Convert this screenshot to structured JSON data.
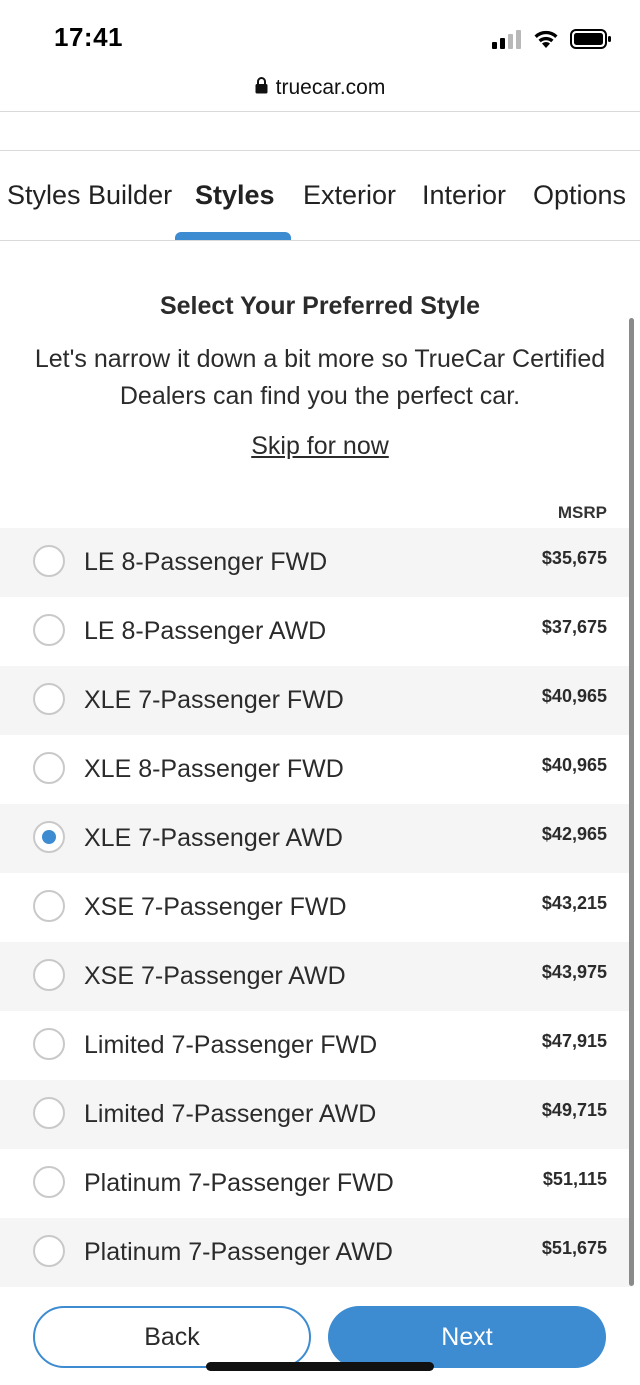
{
  "status_bar": {
    "time": "17:41"
  },
  "url_bar": {
    "domain": "truecar.com"
  },
  "tabs": [
    {
      "label": "Styles Builder",
      "active": false
    },
    {
      "label": "Styles",
      "active": true
    },
    {
      "label": "Exterior",
      "active": false
    },
    {
      "label": "Interior",
      "active": false
    },
    {
      "label": "Options",
      "active": false
    }
  ],
  "intro": {
    "title": "Select Your Preferred Style",
    "description": "Let's narrow it down a bit more so TrueCar Certified Dealers can find you the perfect car.",
    "skip_label": "Skip for now"
  },
  "list": {
    "price_header": "MSRP",
    "styles": [
      {
        "name": "LE 8-Passenger FWD",
        "price": "$35,675",
        "selected": false
      },
      {
        "name": "LE 8-Passenger AWD",
        "price": "$37,675",
        "selected": false
      },
      {
        "name": "XLE 7-Passenger FWD",
        "price": "$40,965",
        "selected": false
      },
      {
        "name": "XLE 8-Passenger FWD",
        "price": "$40,965",
        "selected": false
      },
      {
        "name": "XLE 7-Passenger AWD",
        "price": "$42,965",
        "selected": true
      },
      {
        "name": "XSE 7-Passenger FWD",
        "price": "$43,215",
        "selected": false
      },
      {
        "name": "XSE 7-Passenger AWD",
        "price": "$43,975",
        "selected": false
      },
      {
        "name": "Limited 7-Passenger FWD",
        "price": "$47,915",
        "selected": false
      },
      {
        "name": "Limited 7-Passenger AWD",
        "price": "$49,715",
        "selected": false
      },
      {
        "name": "Platinum 7-Passenger FWD",
        "price": "$51,115",
        "selected": false
      },
      {
        "name": "Platinum 7-Passenger AWD",
        "price": "$51,675",
        "selected": false
      }
    ]
  },
  "actions": {
    "back_label": "Back",
    "next_label": "Next"
  },
  "colors": {
    "accent": "#3d8bd0",
    "row_shade": "#f5f5f5"
  },
  "icons": {
    "signal": "cellular-signal-icon",
    "wifi": "wifi-icon",
    "battery": "battery-icon",
    "lock": "lock-icon"
  }
}
